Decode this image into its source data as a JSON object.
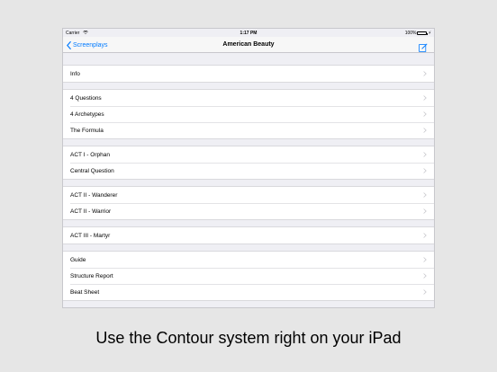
{
  "status_bar": {
    "carrier": "Carrier",
    "time": "1:17 PM",
    "battery": "100%"
  },
  "nav": {
    "back_label": "Screenplays",
    "title": "American Beauty"
  },
  "sections": [
    {
      "items": [
        "Info"
      ]
    },
    {
      "items": [
        "4 Questions",
        "4 Archetypes",
        "The Formula"
      ]
    },
    {
      "items": [
        "ACT I - Orphan",
        "Central Question"
      ]
    },
    {
      "items": [
        "ACT II - Wanderer",
        "ACT II - Warrior"
      ]
    },
    {
      "items": [
        "ACT III - Martyr"
      ]
    },
    {
      "items": [
        "Guide",
        "Structure Report",
        "Beat Sheet"
      ]
    }
  ],
  "caption": "Use the Contour system right on your iPad",
  "colors": {
    "accent": "#007aff",
    "background": "#efeff4",
    "battery": "#4cd964"
  },
  "icons": {
    "back": "chevron-left-icon",
    "compose": "compose-icon",
    "row": "chevron-right-icon"
  }
}
